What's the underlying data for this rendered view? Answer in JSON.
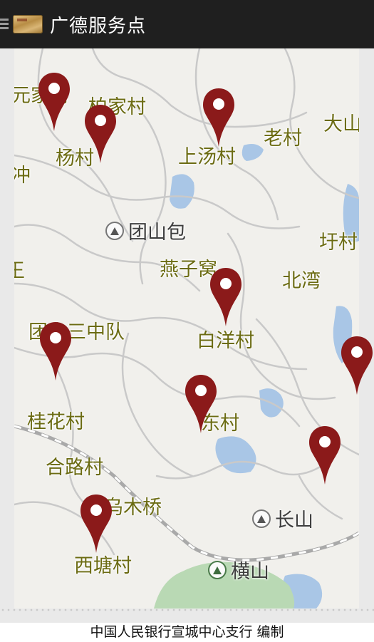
{
  "header": {
    "title": "广德服务点",
    "menu_icon": "hamburger-menu-icon",
    "logo_icon": "bank-card-logo-icon"
  },
  "map": {
    "places": [
      {
        "id": "p1",
        "label": "元家村"
      },
      {
        "id": "p2",
        "label": "柏家村"
      },
      {
        "id": "p3",
        "label": "杨村"
      },
      {
        "id": "p4",
        "label": "冲"
      },
      {
        "id": "p5",
        "label": "上汤村"
      },
      {
        "id": "p6",
        "label": "老村"
      },
      {
        "id": "p7",
        "label": "大山"
      },
      {
        "id": "p8",
        "label": "圩村"
      },
      {
        "id": "p9",
        "label": "燕子窝"
      },
      {
        "id": "p10",
        "label": "北湾"
      },
      {
        "id": "p11",
        "label": "团山三中队"
      },
      {
        "id": "p12",
        "label": "白洋村"
      },
      {
        "id": "p13",
        "label": "桂花村"
      },
      {
        "id": "p14",
        "label": "东村"
      },
      {
        "id": "p15",
        "label": "合路村"
      },
      {
        "id": "p16",
        "label": "乌木桥"
      },
      {
        "id": "p17",
        "label": "西塘村"
      },
      {
        "id": "p18",
        "label": "王"
      }
    ],
    "pois": [
      {
        "id": "poi1",
        "label": "团山包",
        "icon": "mountain-icon"
      },
      {
        "id": "poi2",
        "label": "长山",
        "icon": "mountain-icon"
      },
      {
        "id": "poi3",
        "label": "横山",
        "icon": "mountain-icon"
      }
    ],
    "pin_color": "#8b1a1a",
    "pin_count": 10
  },
  "footer": {
    "text": "中国人民银行宣城中心支行 编制"
  }
}
